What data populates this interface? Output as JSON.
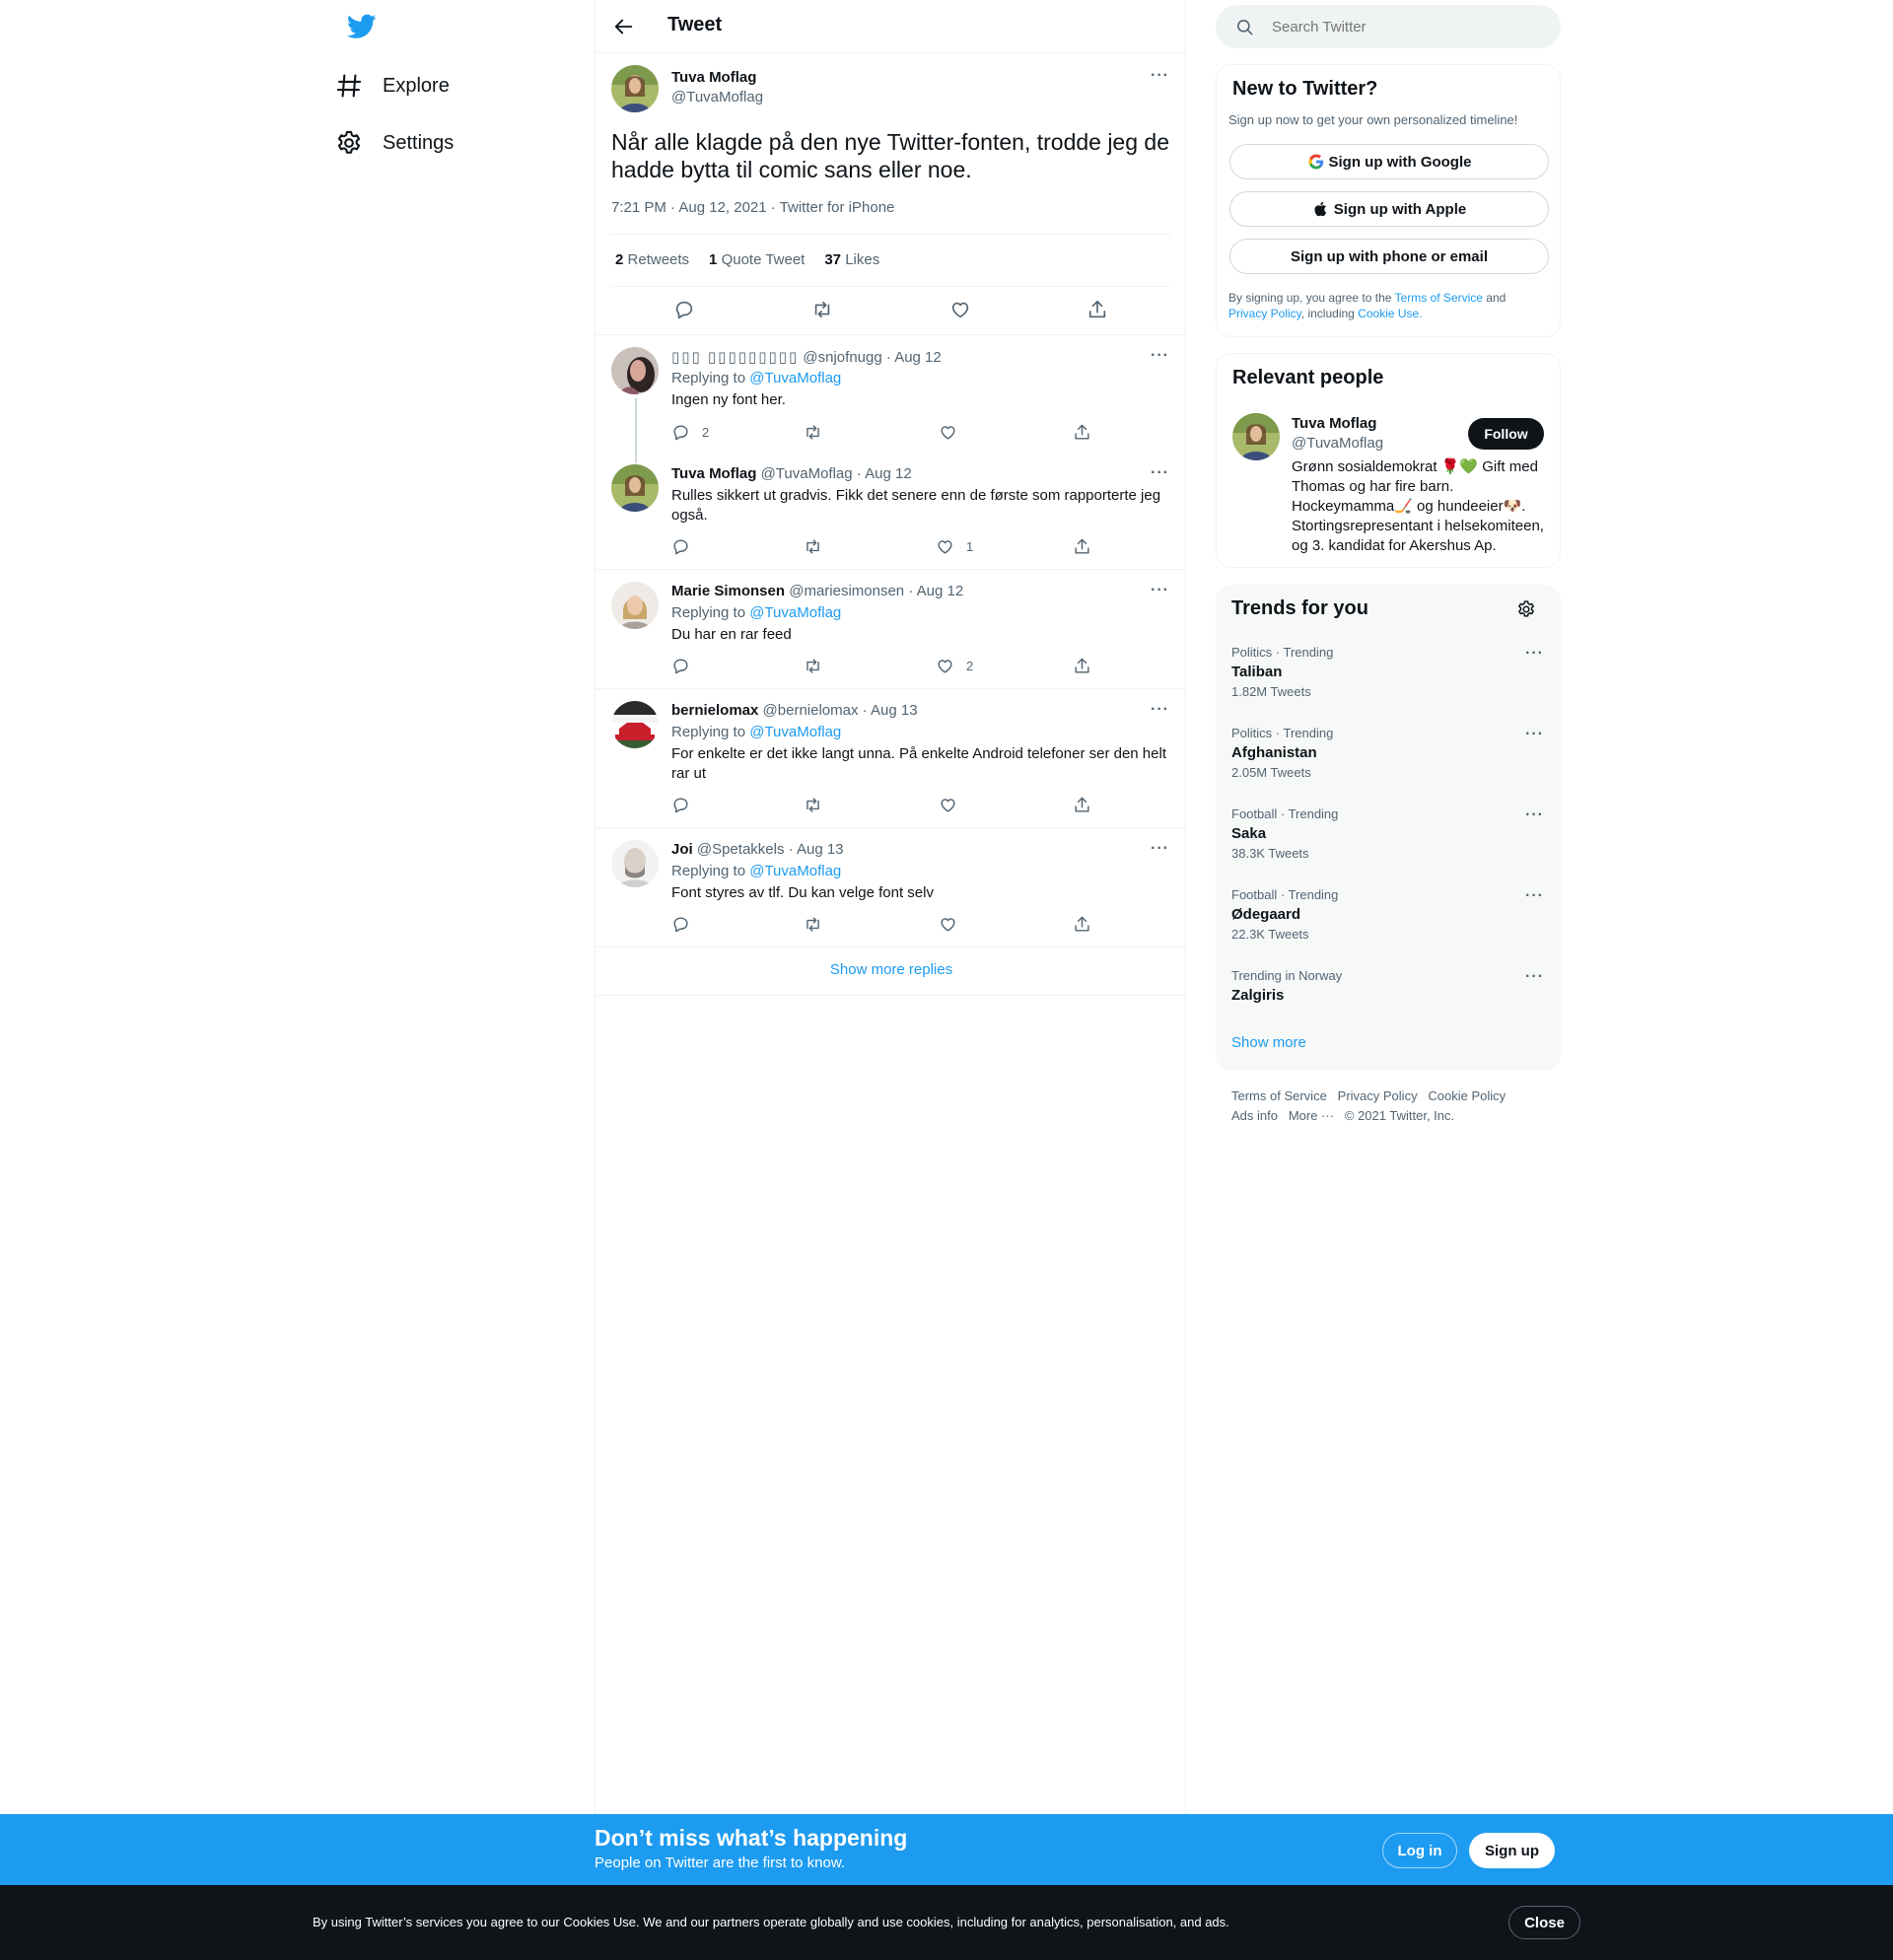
{
  "nav": {
    "explore": "Explore",
    "settings": "Settings"
  },
  "header": {
    "title": "Tweet"
  },
  "tweet": {
    "name": "Tuva Moflag",
    "handle": "@TuvaMoflag",
    "text_line1": "Når alle klagde på den nye Twitter-fonten, trodde jeg de",
    "text_line2": "hadde bytta til comic sans eller noe.",
    "meta": "7:21 PM · Aug 12, 2021 · Twitter for iPhone",
    "retweets_count": "2",
    "retweets_label": "Retweets",
    "quotes_count": "1",
    "quotes_label": "Quote Tweet",
    "likes_count": "37",
    "likes_label": "Likes"
  },
  "replies": [
    {
      "name": "             ",
      "name_display": "▯▯▯ ▯▯▯▯▯▯▯▯▯",
      "handle": "@snjofnugg",
      "date": "· Aug 12",
      "replying": "Replying to",
      "mention": "@TuvaMoflag",
      "text": "Ingen ny font her.",
      "reply_count": "2",
      "like_count": ""
    },
    {
      "name": "Tuva Moflag",
      "handle": "@TuvaMoflag",
      "date": "· Aug 12",
      "text_line1": "Rulles sikkert ut gradvis. Fikk det senere enn de første som rapporterte jeg",
      "text_line2": "også.",
      "reply_count": "",
      "like_count": "1"
    },
    {
      "name": "Marie Simonsen",
      "handle": "@mariesimonsen",
      "date": "· Aug 12",
      "replying": "Replying to",
      "mention": "@TuvaMoflag",
      "text": "Du har en rar feed",
      "reply_count": "",
      "like_count": "2"
    },
    {
      "name": "bernielomax",
      "handle": "@bernielomax",
      "date": "· Aug 13",
      "replying": "Replying to",
      "mention": "@TuvaMoflag",
      "text_line1": "For enkelte er det ikke langt unna. På enkelte Android telefoner ser den helt",
      "text_line2": "rar ut",
      "reply_count": "",
      "like_count": ""
    },
    {
      "name": "Joi",
      "handle": "@Spetakkels",
      "date": "· Aug 13",
      "replying": "Replying to",
      "mention": "@TuvaMoflag",
      "text": "Font styres av tlf. Du kan velge font selv",
      "reply_count": "",
      "like_count": ""
    }
  ],
  "show_more_replies": "Show more replies",
  "search": {
    "placeholder": "Search Twitter"
  },
  "new_to_twitter": {
    "title": "New to Twitter?",
    "subtitle": "Sign up now to get your own personalized timeline!",
    "google": "Sign up with Google",
    "apple": "Sign up with Apple",
    "phone": "Sign up with phone or email",
    "terms_prefix": "By signing up, you agree to the",
    "terms_link": "Terms of Service",
    "terms_and": "and",
    "privacy_link": "Privacy Policy",
    "including": ", including",
    "cookie_link": "Cookie Use."
  },
  "relevant": {
    "title": "Relevant people",
    "name": "Tuva Moflag",
    "handle": "@TuvaMoflag",
    "follow": "Follow",
    "bio1": "Grønn sosialdemokrat 🌹💚 Gift med",
    "bio2": "Thomas og har fire barn.",
    "bio3": "Hockeymamma🏒 og hundeeier🐶.",
    "bio4": "Stortingsrepresentant i helsekomiteen,",
    "bio5": "og 3. kandidat for Akershus Ap."
  },
  "trends": {
    "title": "Trends for you",
    "items": [
      {
        "category": "Politics · Trending",
        "name": "Taliban",
        "count": "1.82M Tweets"
      },
      {
        "category": "Politics · Trending",
        "name": "Afghanistan",
        "count": "2.05M Tweets"
      },
      {
        "category": "Football · Trending",
        "name": "Saka",
        "count": "38.3K Tweets"
      },
      {
        "category": "Football · Trending",
        "name": "Ødegaard",
        "count": "22.3K Tweets"
      },
      {
        "category": "Trending in Norway",
        "name": "Zalgiris",
        "count": ""
      }
    ],
    "show_more": "Show more"
  },
  "footer": {
    "terms": "Terms of Service",
    "privacy": "Privacy Policy",
    "cookie": "Cookie Policy",
    "ads": "Ads info",
    "more": "More ···",
    "copyright": "© 2021 Twitter, Inc."
  },
  "banner": {
    "title": "Don’t miss what’s happening",
    "subtitle": "People on Twitter are the first to know.",
    "login": "Log in",
    "signup": "Sign up"
  },
  "cookie": {
    "text": "By using Twitter’s services you agree to our Cookies Use. We and our partners operate globally and use cookies, including for analytics, personalisation, and ads.",
    "close": "Close"
  },
  "colors": {
    "accent": "#1d9bf0",
    "text": "#0f1419",
    "secondary": "#536471",
    "banner": "#1d9bf0",
    "cookie_bg": "#0f1419"
  }
}
